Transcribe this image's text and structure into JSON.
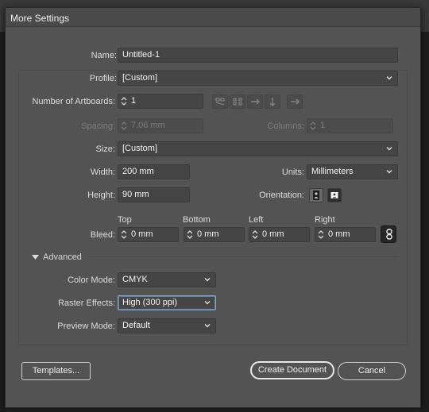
{
  "dialog": {
    "title": "More Settings"
  },
  "fields": {
    "name_label": "Name:",
    "name_value": "Untitled-1",
    "profile_label": "Profile:",
    "profile_value": "[Custom]",
    "artboards_label": "Number of Artboards:",
    "artboards_value": "1",
    "spacing_label": "Spacing:",
    "spacing_value": "7.06 mm",
    "columns_label": "Columns:",
    "columns_value": "1",
    "size_label": "Size:",
    "size_value": "[Custom]",
    "width_label": "Width:",
    "width_value": "200 mm",
    "units_label": "Units:",
    "units_value": "Millimeters",
    "height_label": "Height:",
    "height_value": "90 mm",
    "orientation_label": "Orientation:"
  },
  "bleed": {
    "label": "Bleed:",
    "top_label": "Top",
    "top_value": "0 mm",
    "bottom_label": "Bottom",
    "bottom_value": "0 mm",
    "left_label": "Left",
    "left_value": "0 mm",
    "right_label": "Right",
    "right_value": "0 mm"
  },
  "advanced": {
    "toggle_label": "Advanced",
    "color_mode_label": "Color Mode:",
    "color_mode_value": "CMYK",
    "raster_effects_label": "Raster Effects:",
    "raster_effects_value": "High (300 ppi)",
    "preview_mode_label": "Preview Mode:",
    "preview_mode_value": "Default"
  },
  "buttons": {
    "templates": "Templates...",
    "create": "Create Document",
    "cancel": "Cancel"
  }
}
